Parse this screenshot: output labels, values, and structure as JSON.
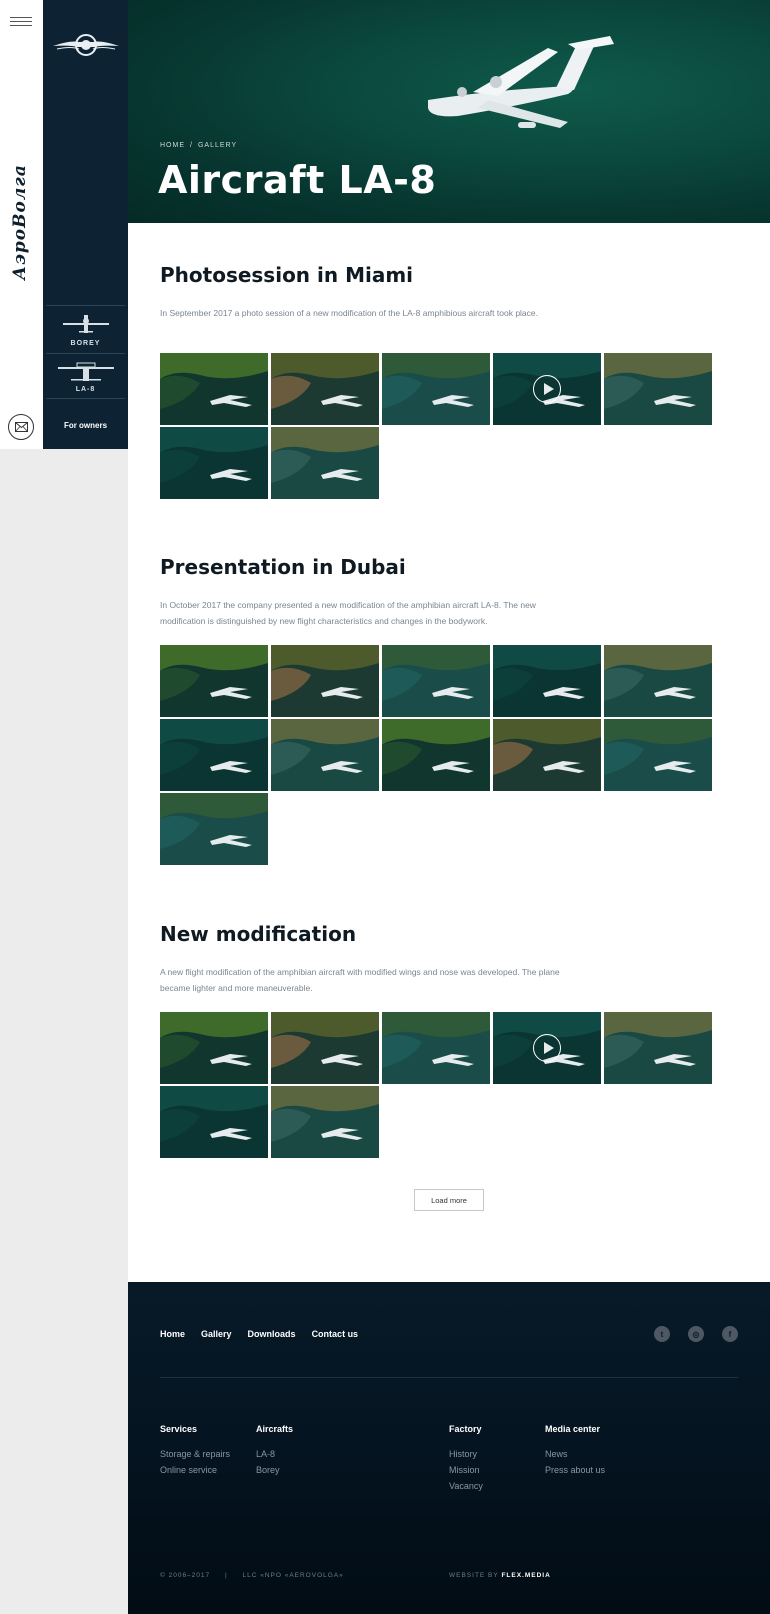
{
  "brand": {
    "name": "АэроВолга"
  },
  "sidebar": {
    "items": [
      {
        "label": "BOREY"
      },
      {
        "label": "LA-8"
      }
    ],
    "owners_label": "For owners"
  },
  "hero": {
    "breadcrumb": [
      "HOME",
      "GALLERY"
    ],
    "breadcrumb_sep": "/",
    "title": "Aircraft LA-8"
  },
  "sections": [
    {
      "title": "Photosession in Miami",
      "text": "In September 2017 a photo session of a new modification of the LA-8 amphibious aircraft took place.",
      "thumbs": [
        {
          "kind": "coast",
          "video": false
        },
        {
          "kind": "town",
          "video": false
        },
        {
          "kind": "lake",
          "video": false
        },
        {
          "kind": "sea",
          "video": true
        },
        {
          "kind": "harbor",
          "video": false
        },
        {
          "kind": "sea",
          "video": false
        },
        {
          "kind": "harbor",
          "video": false
        }
      ]
    },
    {
      "title": "Presentation in Dubai",
      "text": "In October 2017 the company presented a new modification of the amphibian aircraft LA-8. The new modification is distinguished by new flight characteristics and changes in the bodywork.",
      "thumbs": [
        {
          "kind": "coast",
          "video": false
        },
        {
          "kind": "town",
          "video": false
        },
        {
          "kind": "lake",
          "video": false
        },
        {
          "kind": "sea",
          "video": false
        },
        {
          "kind": "harbor",
          "video": false
        },
        {
          "kind": "sea",
          "video": false
        },
        {
          "kind": "harbor",
          "video": false
        },
        {
          "kind": "coast",
          "video": false
        },
        {
          "kind": "town",
          "video": false
        },
        {
          "kind": "lake",
          "video": false
        },
        {
          "kind": "lake",
          "video": false
        }
      ]
    },
    {
      "title": "New modification",
      "text": "A new flight modification of the amphibian aircraft with modified wings and nose was developed. The plane became lighter and more maneuverable.",
      "thumbs": [
        {
          "kind": "coast",
          "video": false
        },
        {
          "kind": "town",
          "video": false
        },
        {
          "kind": "lake",
          "video": false
        },
        {
          "kind": "sea",
          "video": true
        },
        {
          "kind": "harbor",
          "video": false
        },
        {
          "kind": "sea",
          "video": false
        },
        {
          "kind": "harbor",
          "video": false
        }
      ]
    }
  ],
  "load_more": "Load more",
  "footer": {
    "nav": [
      "Home",
      "Gallery",
      "Downloads",
      "Contact us"
    ],
    "socials": [
      {
        "icon": "twitter-icon",
        "glyph": "t"
      },
      {
        "icon": "instagram-icon",
        "glyph": "◎"
      },
      {
        "icon": "facebook-icon",
        "glyph": "f"
      }
    ],
    "columns": [
      {
        "title": "Services",
        "links": [
          "Storage & repairs",
          "Online service"
        ]
      },
      {
        "title": "Aircrafts",
        "links": [
          "LA-8",
          "Borey"
        ]
      },
      {
        "title": "Factory",
        "links": [
          "History",
          "Mission",
          "Vacancy"
        ]
      },
      {
        "title": "Media center",
        "links": [
          "News",
          "Press about us"
        ]
      }
    ],
    "copyright": "© 2006–2017",
    "divider": "|",
    "company": "LLC «NPO «AEROVOLGA»",
    "website_by": "WEBSITE BY",
    "agency": "FLEX.MEDIA"
  },
  "colors": {
    "navy": "#0d2333",
    "hero_sea": "#0b4a3f",
    "footer_bg": "#04131f",
    "text_muted": "#7b8590"
  }
}
